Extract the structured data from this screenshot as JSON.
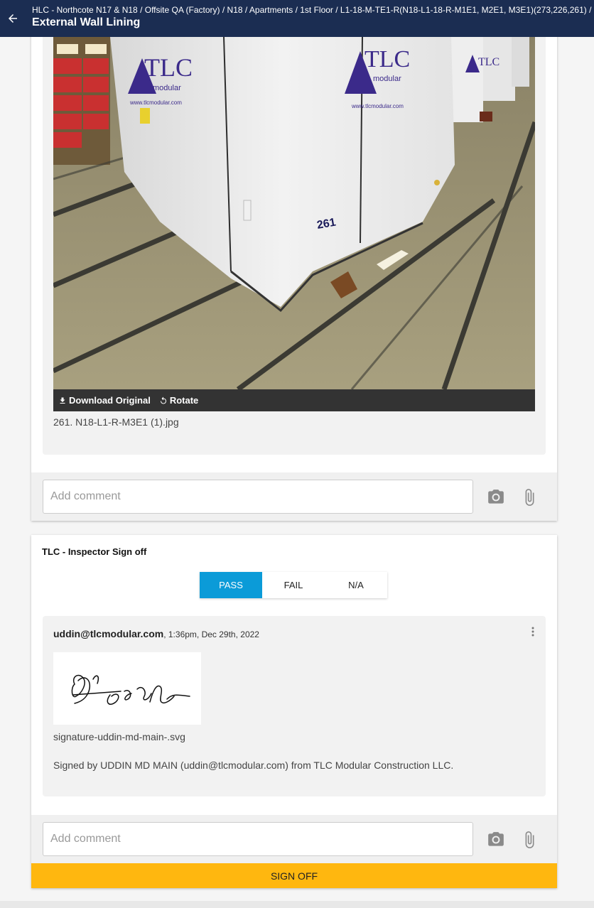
{
  "header": {
    "breadcrumb": "HLC - Northcote N17 & N18 / Offsite QA (Factory) / N18 / Apartments / 1st Floor / L1-18-M-TE1-R(N18-L1-18-R-M1E1, M2E1, M3E1)(273,226,261) /",
    "title": "External Wall Lining",
    "back_icon": "arrow-left-icon"
  },
  "photo_attachment": {
    "download_label": "Download Original",
    "rotate_label": "Rotate",
    "filename": "261. N18-L1-R-M3E1 (1).jpg",
    "photo_text": {
      "brand": "TLC",
      "brand_sub": "modular",
      "website": "www.tlcmodular.com",
      "unit_number": "261"
    }
  },
  "comment_box_1": {
    "placeholder": "Add comment",
    "camera_icon": "camera-icon",
    "attach_icon": "paperclip-icon"
  },
  "signoff_section": {
    "title": "TLC - Inspector Sign off",
    "options": [
      "PASS",
      "FAIL",
      "N/A"
    ],
    "selected": "PASS",
    "accent_color": "#0b9bd8",
    "entry": {
      "author": "uddin@tlcmodular.com",
      "timestamp": ", 1:36pm, Dec 29th, 2022",
      "signature_filename": "signature-uddin-md-main-.svg",
      "signed_by": "Signed by UDDIN MD MAIN (uddin@tlcmodular.com) from TLC Modular Construction LLC."
    },
    "button_label": "SIGN OFF",
    "button_color": "#ffb70f"
  },
  "comment_box_2": {
    "placeholder": "Add comment",
    "camera_icon": "camera-icon",
    "attach_icon": "paperclip-icon"
  }
}
